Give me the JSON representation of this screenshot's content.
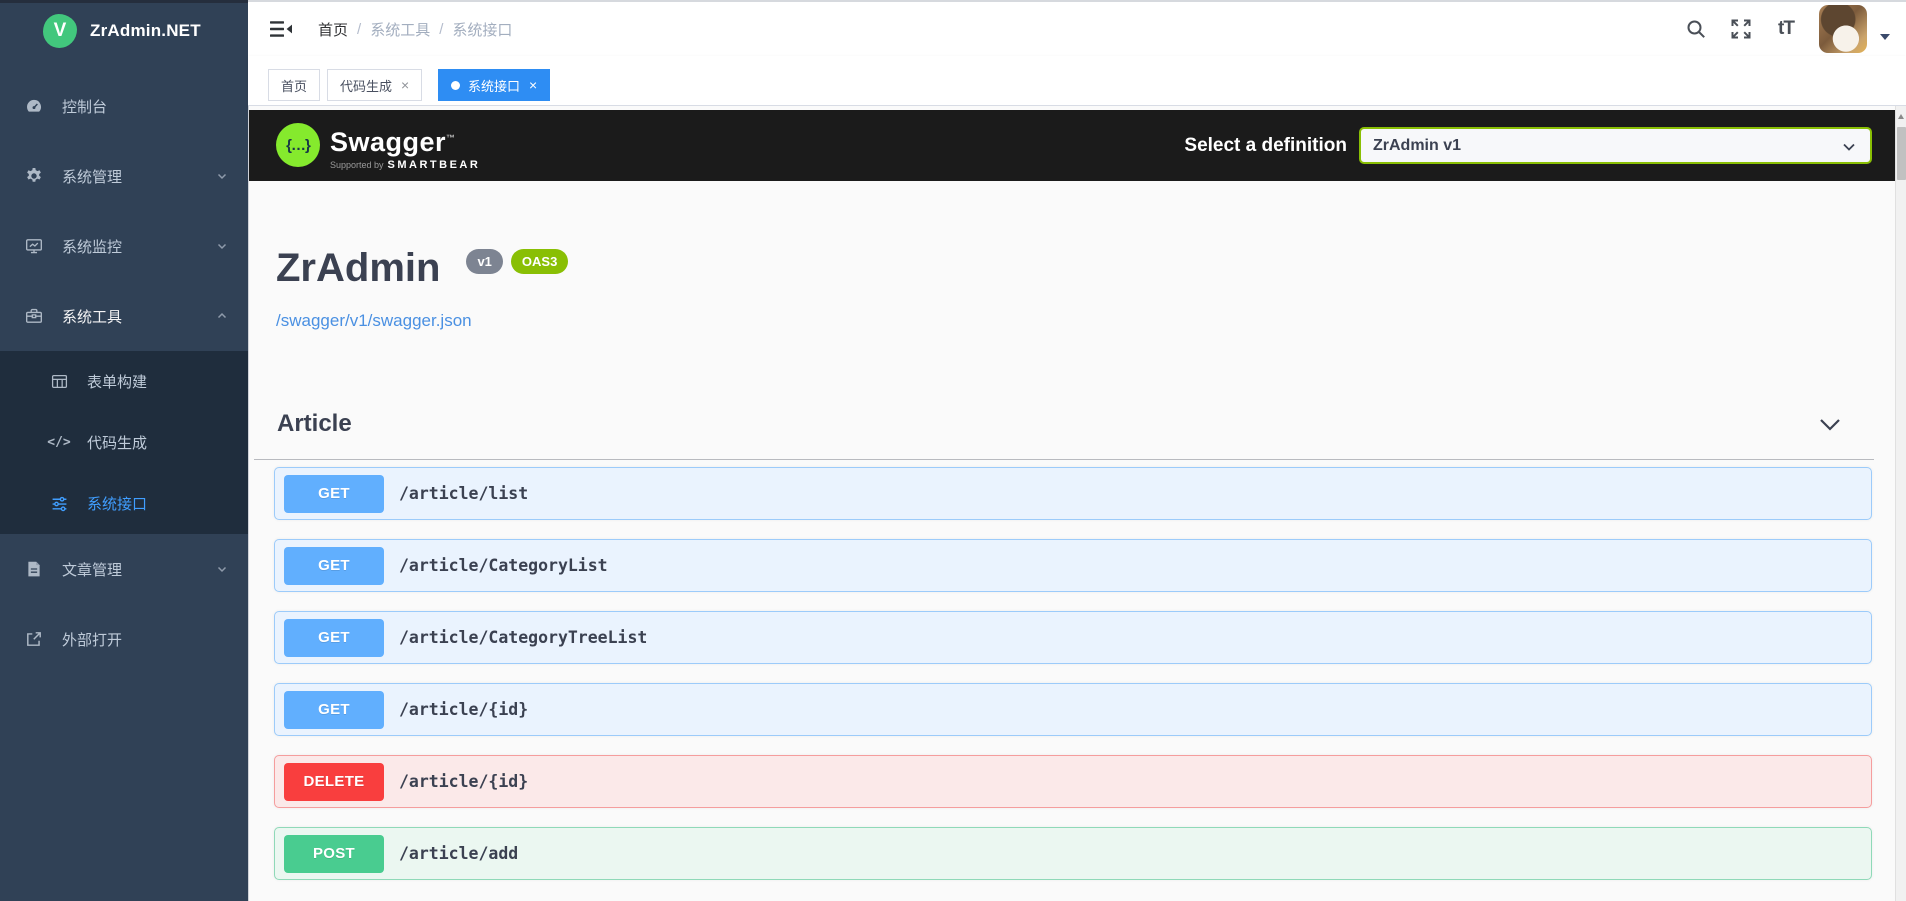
{
  "sidebar": {
    "logo_letter": "V",
    "logo_text": "ZrAdmin.NET",
    "items": [
      {
        "label": "控制台",
        "icon": "dashboard-icon"
      },
      {
        "label": "系统管理",
        "icon": "gear-icon",
        "state": "collapsed"
      },
      {
        "label": "系统监控",
        "icon": "monitor-icon",
        "state": "collapsed"
      },
      {
        "label": "系统工具",
        "icon": "toolbox-icon",
        "state": "expanded",
        "children": [
          {
            "label": "表单构建",
            "icon": "table-icon"
          },
          {
            "label": "代码生成",
            "icon": "code-icon",
            "glyph": "</>"
          },
          {
            "label": "系统接口",
            "icon": "sliders-icon",
            "active": true
          }
        ]
      },
      {
        "label": "文章管理",
        "icon": "document-icon",
        "state": "collapsed"
      },
      {
        "label": "外部打开",
        "icon": "external-link-icon"
      }
    ]
  },
  "navbar": {
    "breadcrumb": [
      "首页",
      "系统工具",
      "系统接口"
    ],
    "separator": "/",
    "font_size_glyph": "tT"
  },
  "tabbar": {
    "close_glyph": "×",
    "tabs": [
      {
        "label": "首页",
        "closable": false,
        "active": false
      },
      {
        "label": "代码生成",
        "closable": true,
        "active": false
      },
      {
        "label": "系统接口",
        "closable": true,
        "active": true
      }
    ]
  },
  "swagger": {
    "topbar": {
      "brand": "Swagger",
      "trademark": "™",
      "supported_by": "Supported by",
      "sponsor": "SMARTBEAR",
      "select_label": "Select a definition",
      "select_value": "ZrAdmin v1"
    },
    "info": {
      "title": "ZrAdmin",
      "version_badge": "v1",
      "oas_badge": "OAS3",
      "spec_url": "/swagger/v1/swagger.json"
    },
    "section": {
      "name": "Article"
    },
    "endpoints": [
      {
        "method": "GET",
        "path": "/article/list"
      },
      {
        "method": "GET",
        "path": "/article/CategoryList"
      },
      {
        "method": "GET",
        "path": "/article/CategoryTreeList"
      },
      {
        "method": "GET",
        "path": "/article/{id}"
      },
      {
        "method": "DELETE",
        "path": "/article/{id}"
      },
      {
        "method": "POST",
        "path": "/article/add"
      }
    ]
  },
  "theme": {
    "primary_blue": "#2e8df3",
    "active_link_blue": "#409eff",
    "sidebar_bg": "#304156",
    "submenu_bg": "#1f2d3d",
    "swagger_topbar_bg": "#1b1b1b",
    "swagger_green": "#85ea2d",
    "logo_green": "#42c77d",
    "get_color": "#61affe",
    "post_color": "#49cc90",
    "delete_color": "#f93e3e",
    "oas3_badge_color": "#89bf04",
    "version_badge_color": "#7d8492",
    "spec_link_color": "#4a90e2"
  }
}
